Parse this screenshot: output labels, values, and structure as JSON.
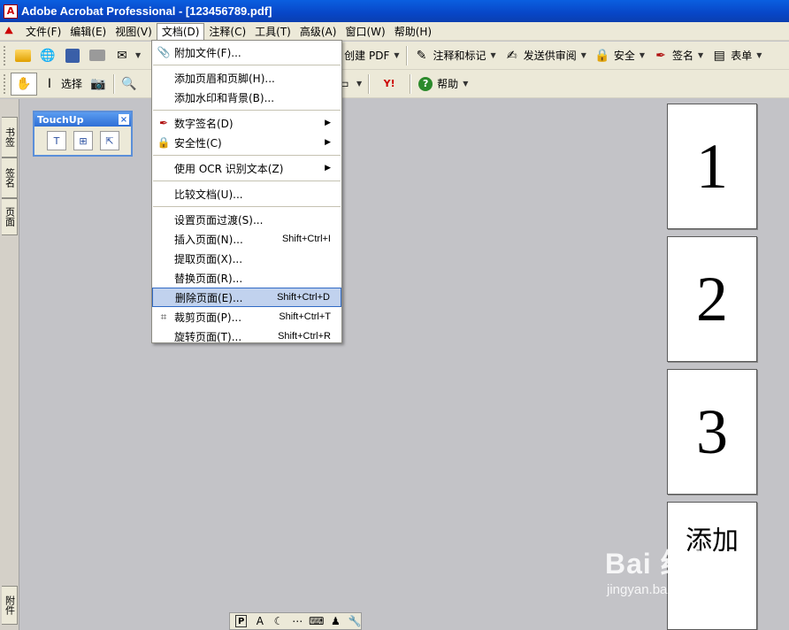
{
  "window": {
    "title": "Adobe Acrobat Professional - [123456789.pdf]"
  },
  "menubar": {
    "items": [
      {
        "label": "文件(F)",
        "active": false
      },
      {
        "label": "编辑(E)",
        "active": false
      },
      {
        "label": "视图(V)",
        "active": false
      },
      {
        "label": "文档(D)",
        "active": true
      },
      {
        "label": "注释(C)",
        "active": false
      },
      {
        "label": "工具(T)",
        "active": false
      },
      {
        "label": "高级(A)",
        "active": false
      },
      {
        "label": "窗口(W)",
        "active": false
      },
      {
        "label": "帮助(H)",
        "active": false
      }
    ]
  },
  "toolbar1": {
    "create_pdf": "创建 PDF",
    "comment_markup": "注释和标记",
    "send_review": "发送供审阅",
    "security": "安全",
    "sign": "签名",
    "forms": "表单"
  },
  "toolbar2": {
    "select": "选择",
    "help": "帮助"
  },
  "sidebar": {
    "tabs": [
      "书签",
      "签名",
      "页面",
      "附件"
    ]
  },
  "touchup": {
    "title": "TouchUp",
    "close": "×"
  },
  "document_menu": {
    "items": [
      {
        "label": "附加文件(F)...",
        "shortcut": "",
        "icon": "paperclip-icon"
      },
      {
        "label": "添加页眉和页脚(H)...",
        "shortcut": "",
        "icon": ""
      },
      {
        "label": "添加水印和背景(B)...",
        "shortcut": "",
        "icon": ""
      },
      {
        "label": "数字签名(D)",
        "shortcut": "",
        "icon": "pen-icon",
        "submenu": true
      },
      {
        "label": "安全性(C)",
        "shortcut": "",
        "icon": "lock-icon",
        "submenu": true
      },
      {
        "label": "使用 OCR 识别文本(Z)",
        "shortcut": "",
        "icon": "",
        "submenu": true
      },
      {
        "label": "比较文档(U)...",
        "shortcut": "",
        "icon": ""
      },
      {
        "label": "设置页面过渡(S)...",
        "shortcut": "",
        "icon": ""
      },
      {
        "label": "插入页面(N)...",
        "shortcut": "Shift+Ctrl+I",
        "icon": ""
      },
      {
        "label": "提取页面(X)...",
        "shortcut": "",
        "icon": ""
      },
      {
        "label": "替换页面(R)...",
        "shortcut": "",
        "icon": ""
      },
      {
        "label": "删除页面(E)...",
        "shortcut": "Shift+Ctrl+D",
        "icon": "",
        "highlighted": true
      },
      {
        "label": "裁剪页面(P)...",
        "shortcut": "Shift+Ctrl+T",
        "icon": "crop-icon"
      },
      {
        "label": "旋转页面(T)...",
        "shortcut": "Shift+Ctrl+R",
        "icon": ""
      }
    ]
  },
  "thumbnails": [
    {
      "text": "1"
    },
    {
      "text": "2"
    },
    {
      "text": "3"
    },
    {
      "text": "添加"
    }
  ],
  "watermark": {
    "brand": "Bai 经验",
    "url": "jingyan.baidu.com"
  }
}
